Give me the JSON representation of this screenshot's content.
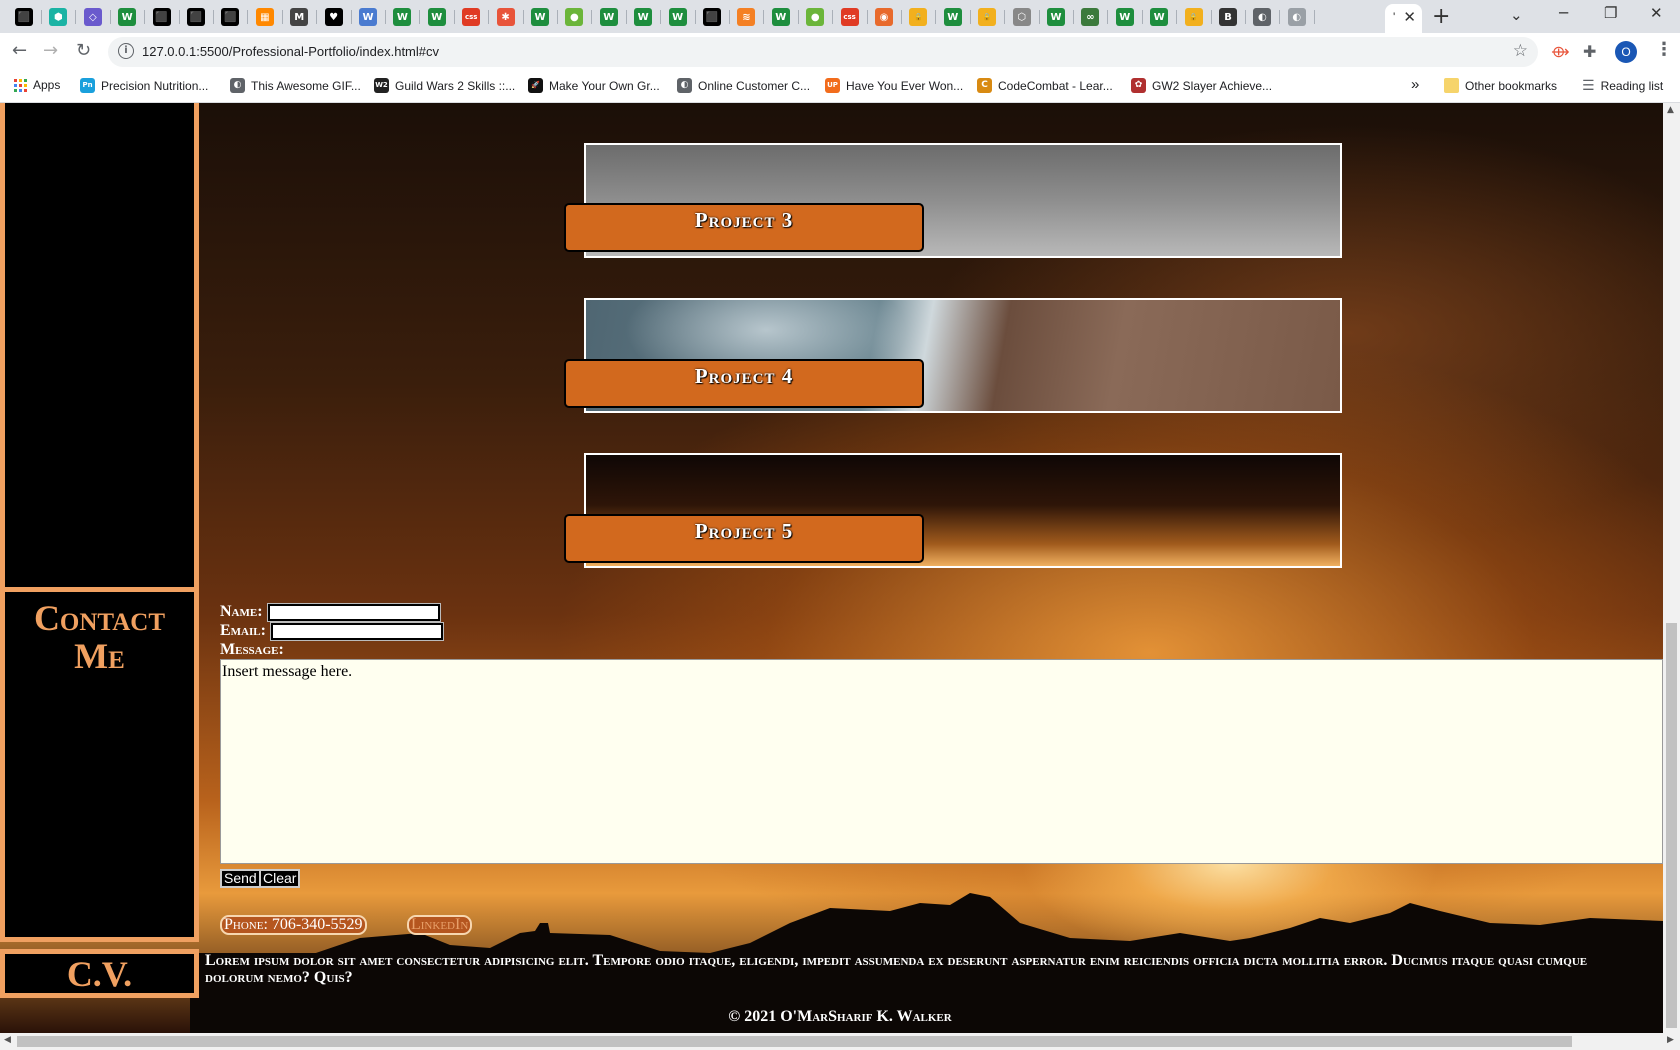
{
  "browser": {
    "tab_icons": [
      {
        "name": "tab-icon-1",
        "color": "#000000"
      },
      {
        "name": "tab-icon-2",
        "color": "#1bb3a4"
      },
      {
        "name": "tab-icon-3",
        "color": "#6a5acd"
      },
      {
        "name": "tab-icon-4",
        "color": "#1e8e3e"
      },
      {
        "name": "tab-icon-5",
        "color": "#000000"
      },
      {
        "name": "tab-icon-6",
        "color": "#000000"
      },
      {
        "name": "tab-icon-7",
        "color": "#000000"
      },
      {
        "name": "tab-icon-8",
        "color": "#ff8800"
      },
      {
        "name": "tab-icon-9",
        "color": "#444444"
      },
      {
        "name": "tab-icon-10",
        "color": "#000000"
      },
      {
        "name": "tab-icon-11",
        "color": "#4a7bd0"
      },
      {
        "name": "tab-icon-12",
        "color": "#1e8e3e"
      },
      {
        "name": "tab-icon-13",
        "color": "#1e8e3e"
      },
      {
        "name": "tab-icon-14",
        "color": "#e03b24"
      },
      {
        "name": "tab-icon-15",
        "color": "#e8543a"
      },
      {
        "name": "tab-icon-16",
        "color": "#1e8e3e"
      },
      {
        "name": "tab-icon-17",
        "color": "#6bb53a"
      },
      {
        "name": "tab-icon-18",
        "color": "#1e8e3e"
      },
      {
        "name": "tab-icon-19",
        "color": "#1e8e3e"
      },
      {
        "name": "tab-icon-20",
        "color": "#1e8e3e"
      },
      {
        "name": "tab-icon-21",
        "color": "#000000"
      },
      {
        "name": "tab-icon-22",
        "color": "#f48024"
      },
      {
        "name": "tab-icon-23",
        "color": "#1e8e3e"
      },
      {
        "name": "tab-icon-24",
        "color": "#6bb53a"
      },
      {
        "name": "tab-icon-25",
        "color": "#e03b24"
      },
      {
        "name": "tab-icon-26",
        "color": "#e86a2c"
      },
      {
        "name": "tab-icon-27",
        "color": "#f2b01e"
      },
      {
        "name": "tab-icon-28",
        "color": "#1e8e3e"
      },
      {
        "name": "tab-icon-29",
        "color": "#f2b01e"
      },
      {
        "name": "tab-icon-30",
        "color": "#888888"
      },
      {
        "name": "tab-icon-31",
        "color": "#1e8e3e"
      },
      {
        "name": "tab-icon-32",
        "color": "#3c7a3c"
      },
      {
        "name": "tab-icon-33",
        "color": "#1e8e3e"
      },
      {
        "name": "tab-icon-34",
        "color": "#1e8e3e"
      },
      {
        "name": "tab-icon-35",
        "color": "#f2b01e"
      },
      {
        "name": "tab-icon-36",
        "color": "#333333"
      },
      {
        "name": "tab-icon-37",
        "color": "#5f6368"
      },
      {
        "name": "tab-icon-38",
        "color": "#9aa0a6"
      }
    ],
    "tab_glyphs": [
      "⬛",
      "⬢",
      "◇",
      "W",
      "⬛",
      "⬛",
      "⬛",
      "▦",
      "M",
      "♥",
      "W",
      "W",
      "W",
      "css",
      "✱",
      "W",
      "●",
      "W",
      "W",
      "W",
      "⬛",
      "≋",
      "W",
      "●",
      "css",
      "◉",
      "🔒",
      "W",
      "🔒",
      "⬡",
      "W",
      "∞",
      "W",
      "W",
      "🔒",
      "B",
      "◐",
      "◐"
    ],
    "active_tab_label": "'",
    "new_tab_label": "+",
    "url": "127.0.0.1:5500/Professional-Portfolio/index.html#cv",
    "profile_initial": "O",
    "bookmarks": [
      {
        "label": "Apps",
        "icon": "apps-grid",
        "color": "#4285f4"
      },
      {
        "label": "Precision Nutrition...",
        "icon": "pn-icon",
        "color": "#1aa0dc",
        "glyph": "Pn"
      },
      {
        "label": "This Awesome GIF...",
        "icon": "globe-icon",
        "color": "#5f6368",
        "glyph": "◐"
      },
      {
        "label": "Guild Wars 2 Skills ::...",
        "icon": "gw2-icon",
        "color": "#222222",
        "glyph": "W2"
      },
      {
        "label": "Make Your Own Gr...",
        "icon": "rocket-icon",
        "color": "#111111",
        "glyph": "🚀"
      },
      {
        "label": "Online Customer C...",
        "icon": "globe-icon",
        "color": "#5f6368",
        "glyph": "◐"
      },
      {
        "label": "Have You Ever Won...",
        "icon": "up-icon",
        "color": "#f26c1c",
        "glyph": "UP"
      },
      {
        "label": "CodeCombat - Lear...",
        "icon": "codecombat-icon",
        "color": "#d88a12",
        "glyph": "C"
      },
      {
        "label": "GW2 Slayer Achieve...",
        "icon": "gw2-slayer-icon",
        "color": "#b03030",
        "glyph": "✿"
      }
    ],
    "bookmarks_overflow": "»",
    "other_bookmarks": "Other bookmarks",
    "reading_list": "Reading list"
  },
  "page": {
    "sidebar": {
      "contact_title": "Contact Me",
      "cv_title": "C.V."
    },
    "projects": [
      {
        "label": "Project 3"
      },
      {
        "label": "Project 4"
      },
      {
        "label": "Project 5"
      }
    ],
    "contact_form": {
      "name_label": "Name:",
      "email_label": "Email:",
      "message_label": "Message:",
      "message_value": "Insert message here.",
      "send_label": "Send",
      "clear_label": "Clear"
    },
    "contact_links": {
      "phone": "Phone: 706-340-5529",
      "linkedin": "LinkedIn"
    },
    "cv_text": "Lorem ipsum dolor sit amet consectetur adipisicing elit. Tempore odio itaque, eligendi, impedit assumenda ex deserunt aspernatur enim reiciendis officia dicta mollitia error. Ducimus itaque quasi cumque dolorum nemo? Quis?",
    "copyright": "© 2021 O'MarSharif K. Walker"
  },
  "colors": {
    "accent_orange": "#d2691e",
    "sidebar_border": "#f0a060",
    "sidebar_bg": "#000000"
  }
}
